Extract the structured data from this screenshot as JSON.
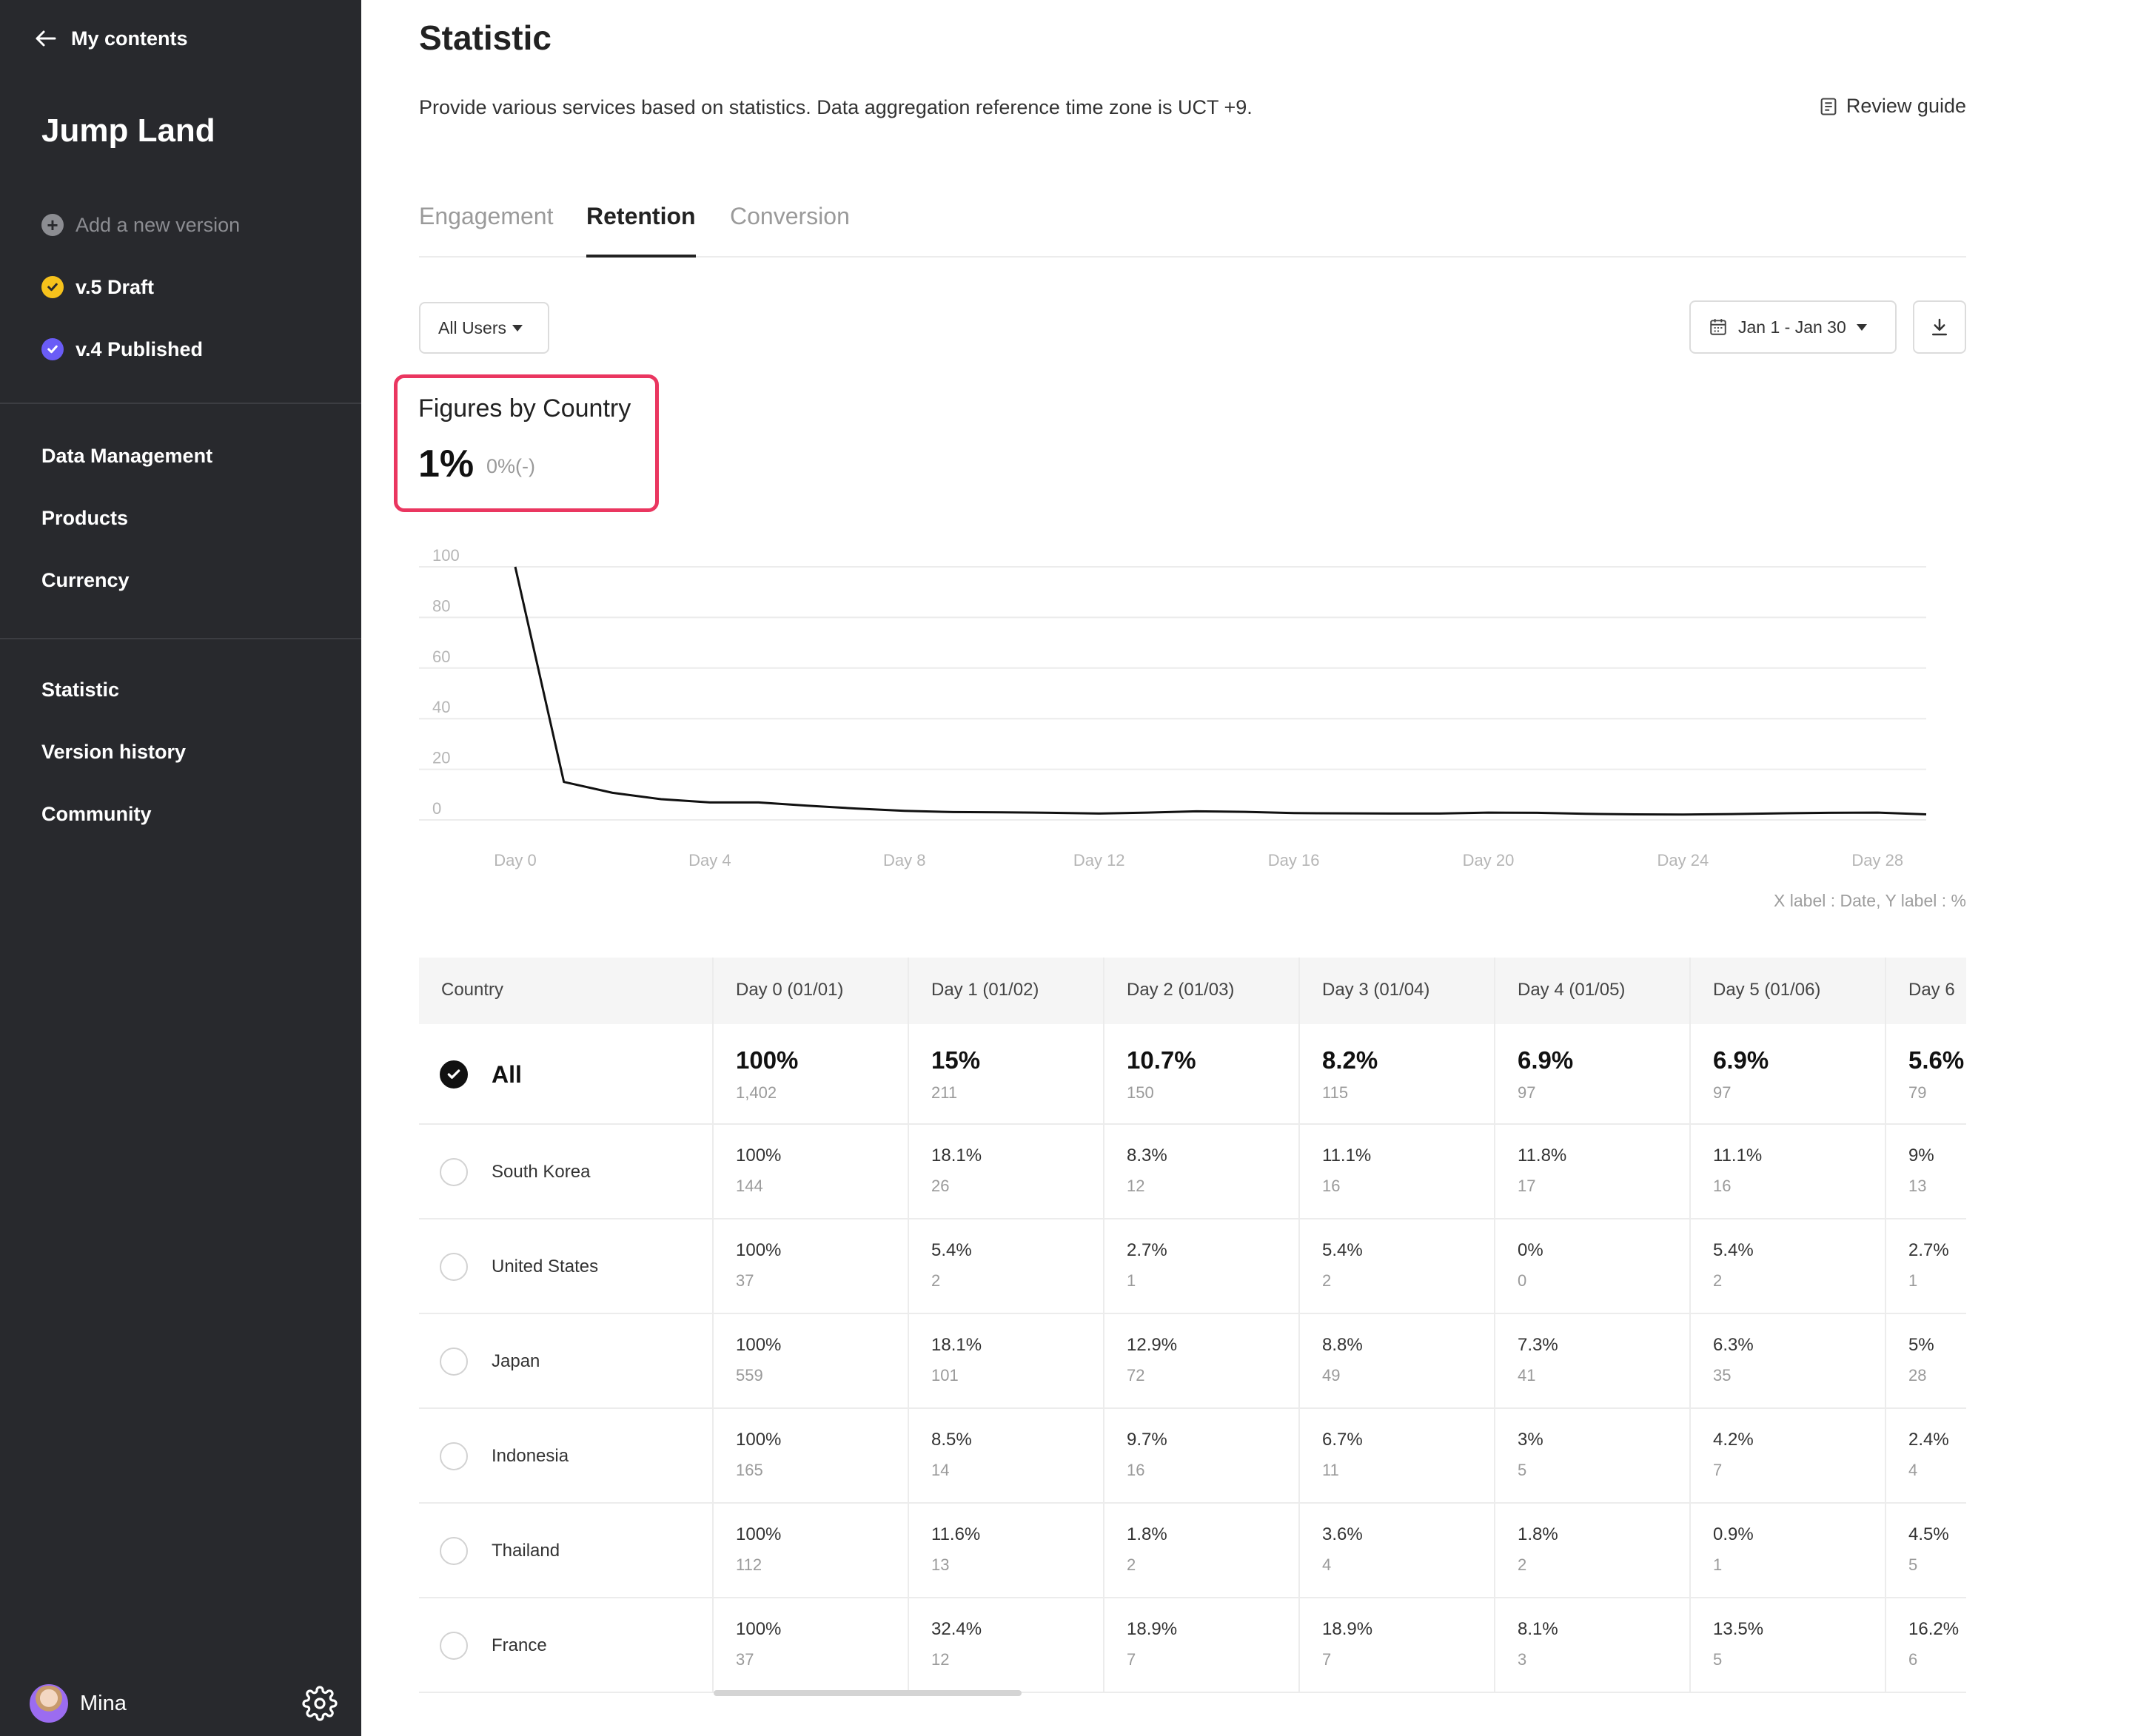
{
  "sidebar": {
    "back_label": "My contents",
    "project_name": "Jump Land",
    "add_version_label": "Add a new version",
    "versions": [
      {
        "label": "v.5 Draft",
        "color": "#f6c21c"
      },
      {
        "label": "v.4 Published",
        "color": "#6a5cf6"
      }
    ],
    "nav_group_1": [
      "Data Management",
      "Products",
      "Currency"
    ],
    "nav_group_2": [
      "Statistic",
      "Version history",
      "Community"
    ],
    "user_name": "Mina"
  },
  "header": {
    "title": "Statistic",
    "description": "Provide various services based on statistics. Data aggregation reference time zone is UCT +9.",
    "review_guide_label": "Review guide"
  },
  "tabs": [
    {
      "label": "Engagement",
      "active": false
    },
    {
      "label": "Retention",
      "active": true
    },
    {
      "label": "Conversion",
      "active": false
    }
  ],
  "filters": {
    "users_label": "All Users",
    "date_range": "Jan 1 - Jan 30"
  },
  "figures": {
    "title": "Figures by Country",
    "value": "1%",
    "delta": "0%(-)"
  },
  "chart_note": "X label : Date, Y label : %",
  "chart_data": {
    "type": "line",
    "title": "",
    "xlabel": "Date",
    "ylabel": "%",
    "ylim": [
      0,
      100
    ],
    "y_ticks": [
      "0",
      "20",
      "40",
      "60",
      "80",
      "100"
    ],
    "x_ticks": [
      "Day 0",
      "Day 4",
      "Day 8",
      "Day 12",
      "Day 16",
      "Day 20",
      "Day 24",
      "Day 28"
    ],
    "x_tick_values": [
      0,
      4,
      8,
      12,
      16,
      20,
      24,
      28
    ],
    "grid": true,
    "series": [
      {
        "color": "#111111",
        "x": [
          0,
          1,
          2,
          3,
          4,
          5,
          6,
          7,
          8,
          9,
          10,
          11,
          12,
          13,
          14,
          15,
          16,
          17,
          18,
          19,
          20,
          21,
          22,
          23,
          24,
          25,
          26,
          27,
          28,
          29
        ],
        "values": [
          100,
          15,
          10.7,
          8.2,
          6.9,
          6.9,
          5.6,
          4.5,
          3.6,
          3.1,
          3.0,
          2.8,
          2.5,
          2.9,
          3.4,
          3.2,
          2.7,
          2.6,
          2.5,
          2.5,
          2.9,
          2.8,
          2.4,
          2.2,
          2.1,
          2.3,
          2.6,
          2.8,
          2.9,
          2.2
        ]
      }
    ]
  },
  "table": {
    "country_header": "Country",
    "day_headers": [
      "Day 0 (01/01)",
      "Day 1 (01/02)",
      "Day 2 (01/03)",
      "Day 3 (01/04)",
      "Day 4 (01/05)",
      "Day 5 (01/06)",
      "Day 6"
    ],
    "rows": [
      {
        "country": "All",
        "checked": true,
        "cells": [
          {
            "pct": "100%",
            "count": "1,402"
          },
          {
            "pct": "15%",
            "count": "211"
          },
          {
            "pct": "10.7%",
            "count": "150"
          },
          {
            "pct": "8.2%",
            "count": "115"
          },
          {
            "pct": "6.9%",
            "count": "97"
          },
          {
            "pct": "6.9%",
            "count": "97"
          },
          {
            "pct": "5.6%",
            "count": "79"
          }
        ]
      },
      {
        "country": "South Korea",
        "checked": false,
        "cells": [
          {
            "pct": "100%",
            "count": "144"
          },
          {
            "pct": "18.1%",
            "count": "26"
          },
          {
            "pct": "8.3%",
            "count": "12"
          },
          {
            "pct": "11.1%",
            "count": "16"
          },
          {
            "pct": "11.8%",
            "count": "17"
          },
          {
            "pct": "11.1%",
            "count": "16"
          },
          {
            "pct": "9%",
            "count": "13"
          }
        ]
      },
      {
        "country": "United States",
        "checked": false,
        "cells": [
          {
            "pct": "100%",
            "count": "37"
          },
          {
            "pct": "5.4%",
            "count": "2"
          },
          {
            "pct": "2.7%",
            "count": "1"
          },
          {
            "pct": "5.4%",
            "count": "2"
          },
          {
            "pct": "0%",
            "count": "0"
          },
          {
            "pct": "5.4%",
            "count": "2"
          },
          {
            "pct": "2.7%",
            "count": "1"
          }
        ]
      },
      {
        "country": "Japan",
        "checked": false,
        "cells": [
          {
            "pct": "100%",
            "count": "559"
          },
          {
            "pct": "18.1%",
            "count": "101"
          },
          {
            "pct": "12.9%",
            "count": "72"
          },
          {
            "pct": "8.8%",
            "count": "49"
          },
          {
            "pct": "7.3%",
            "count": "41"
          },
          {
            "pct": "6.3%",
            "count": "35"
          },
          {
            "pct": "5%",
            "count": "28"
          }
        ]
      },
      {
        "country": "Indonesia",
        "checked": false,
        "cells": [
          {
            "pct": "100%",
            "count": "165"
          },
          {
            "pct": "8.5%",
            "count": "14"
          },
          {
            "pct": "9.7%",
            "count": "16"
          },
          {
            "pct": "6.7%",
            "count": "11"
          },
          {
            "pct": "3%",
            "count": "5"
          },
          {
            "pct": "4.2%",
            "count": "7"
          },
          {
            "pct": "2.4%",
            "count": "4"
          }
        ]
      },
      {
        "country": "Thailand",
        "checked": false,
        "cells": [
          {
            "pct": "100%",
            "count": "112"
          },
          {
            "pct": "11.6%",
            "count": "13"
          },
          {
            "pct": "1.8%",
            "count": "2"
          },
          {
            "pct": "3.6%",
            "count": "4"
          },
          {
            "pct": "1.8%",
            "count": "2"
          },
          {
            "pct": "0.9%",
            "count": "1"
          },
          {
            "pct": "4.5%",
            "count": "5"
          }
        ]
      },
      {
        "country": "France",
        "checked": false,
        "cells": [
          {
            "pct": "100%",
            "count": "37"
          },
          {
            "pct": "32.4%",
            "count": "12"
          },
          {
            "pct": "18.9%",
            "count": "7"
          },
          {
            "pct": "18.9%",
            "count": "7"
          },
          {
            "pct": "8.1%",
            "count": "3"
          },
          {
            "pct": "13.5%",
            "count": "5"
          },
          {
            "pct": "16.2%",
            "count": "6"
          }
        ]
      }
    ]
  }
}
